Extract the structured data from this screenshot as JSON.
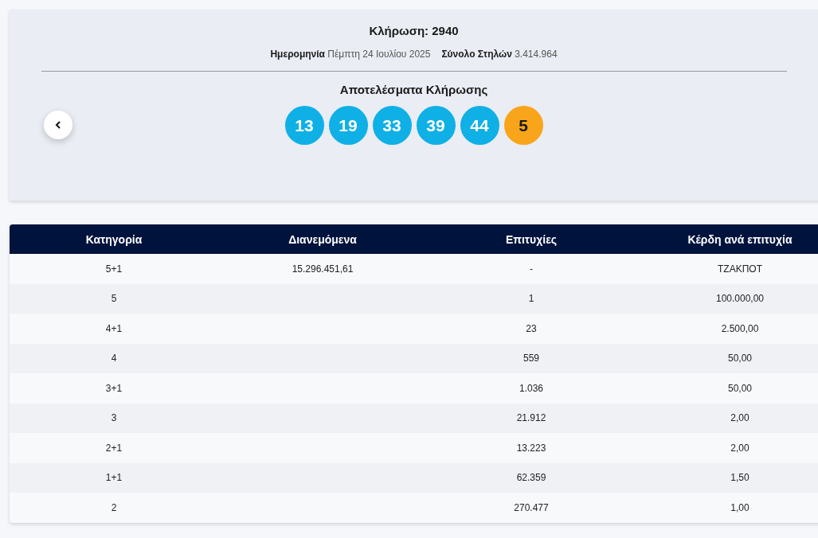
{
  "draw": {
    "title": "Κλήρωση: 2940",
    "meta": [
      {
        "label": "Ημερομηνία",
        "value": "Πέμπτη 24 Ιουλίου 2025"
      },
      {
        "label": "Σύνολο Στηλών",
        "value": "3.414.964"
      }
    ],
    "results_title": "Αποτελέσματα Κλήρωσης",
    "balls": [
      {
        "number": "13",
        "kind": "main"
      },
      {
        "number": "19",
        "kind": "main"
      },
      {
        "number": "33",
        "kind": "main"
      },
      {
        "number": "39",
        "kind": "main"
      },
      {
        "number": "44",
        "kind": "main"
      },
      {
        "number": "5",
        "kind": "bonus"
      }
    ]
  },
  "table": {
    "columns": [
      "Κατηγορία",
      "Διανεμόμενα",
      "Επιτυχίες",
      "Κέρδη ανά επιτυχία"
    ],
    "rows": [
      [
        "5+1",
        "15.296.451,61",
        "-",
        "ΤΖΑΚΠΟΤ"
      ],
      [
        "5",
        "",
        "1",
        "100.000,00"
      ],
      [
        "4+1",
        "",
        "23",
        "2.500,00"
      ],
      [
        "4",
        "",
        "559",
        "50,00"
      ],
      [
        "3+1",
        "",
        "1.036",
        "50,00"
      ],
      [
        "3",
        "",
        "21.912",
        "2,00"
      ],
      [
        "2+1",
        "",
        "13.223",
        "2,00"
      ],
      [
        "1+1",
        "",
        "62.359",
        "1,50"
      ],
      [
        "2",
        "",
        "270.477",
        "1,00"
      ]
    ]
  }
}
